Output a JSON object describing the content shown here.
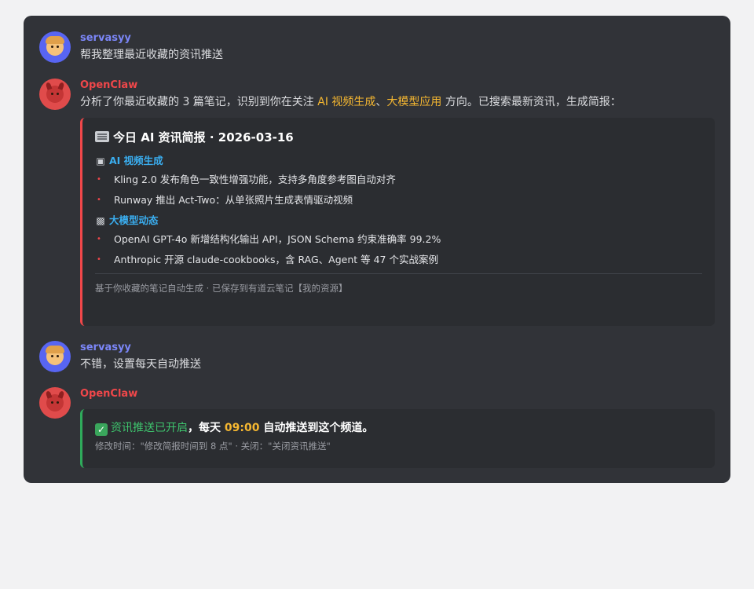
{
  "messages": [
    {
      "author": "servasyy",
      "text": "帮我整理最近收藏的资讯推送"
    },
    {
      "author": "OpenClaw",
      "text_parts": [
        "分析了你最近收藏的 3 篇笔记，识别到你在关注 ",
        "AI 视频生成",
        "、",
        "大模型应用",
        " 方向。已搜索最新资讯，生成简报："
      ],
      "card": {
        "title": "今日 AI 资讯简报 · 2026-03-16",
        "sections": [
          {
            "heading": "AI 视频生成",
            "items": [
              "Kling 2.0 发布角色一致性增强功能，支持多角度参考图自动对齐",
              "Runway 推出 Act-Two：从单张照片生成表情驱动视频"
            ]
          },
          {
            "heading": "大模型动态",
            "items": [
              "OpenAI GPT-4o 新增结构化输出 API，JSON Schema 约束准确率 99.2%",
              "Anthropic 开源 claude-cookbooks，含 RAG、Agent 等 47 个实战案例"
            ]
          }
        ],
        "footnote": "基于你收藏的笔记自动生成 · 已保存到有道云笔记【我的资源】"
      }
    },
    {
      "author": "servasyy",
      "text": "不错，设置每天自动推送"
    },
    {
      "author": "OpenClaw",
      "status_card": {
        "status": "资讯推送已开启",
        "prefix": "，每天 ",
        "time": "09:00",
        "suffix": " 自动推送到这个频道。",
        "hint": "修改时间：\"修改简报时间到 8 点\" · 关闭：\"关闭资讯推送\""
      }
    }
  ],
  "colors": {
    "user_name": "#7b86f7",
    "bot_name": "#f0474a",
    "highlight": "#f5b731",
    "section_heading": "#3aaef0",
    "success": "#3ec46d"
  },
  "icons": {
    "user_avatar": "person-avatar-icon",
    "bot_avatar": "devil-avatar-icon",
    "card_title": "newspaper-icon",
    "section_1": "clapperboard-icon",
    "section_2": "robot-icon",
    "status": "check-mark-icon"
  }
}
